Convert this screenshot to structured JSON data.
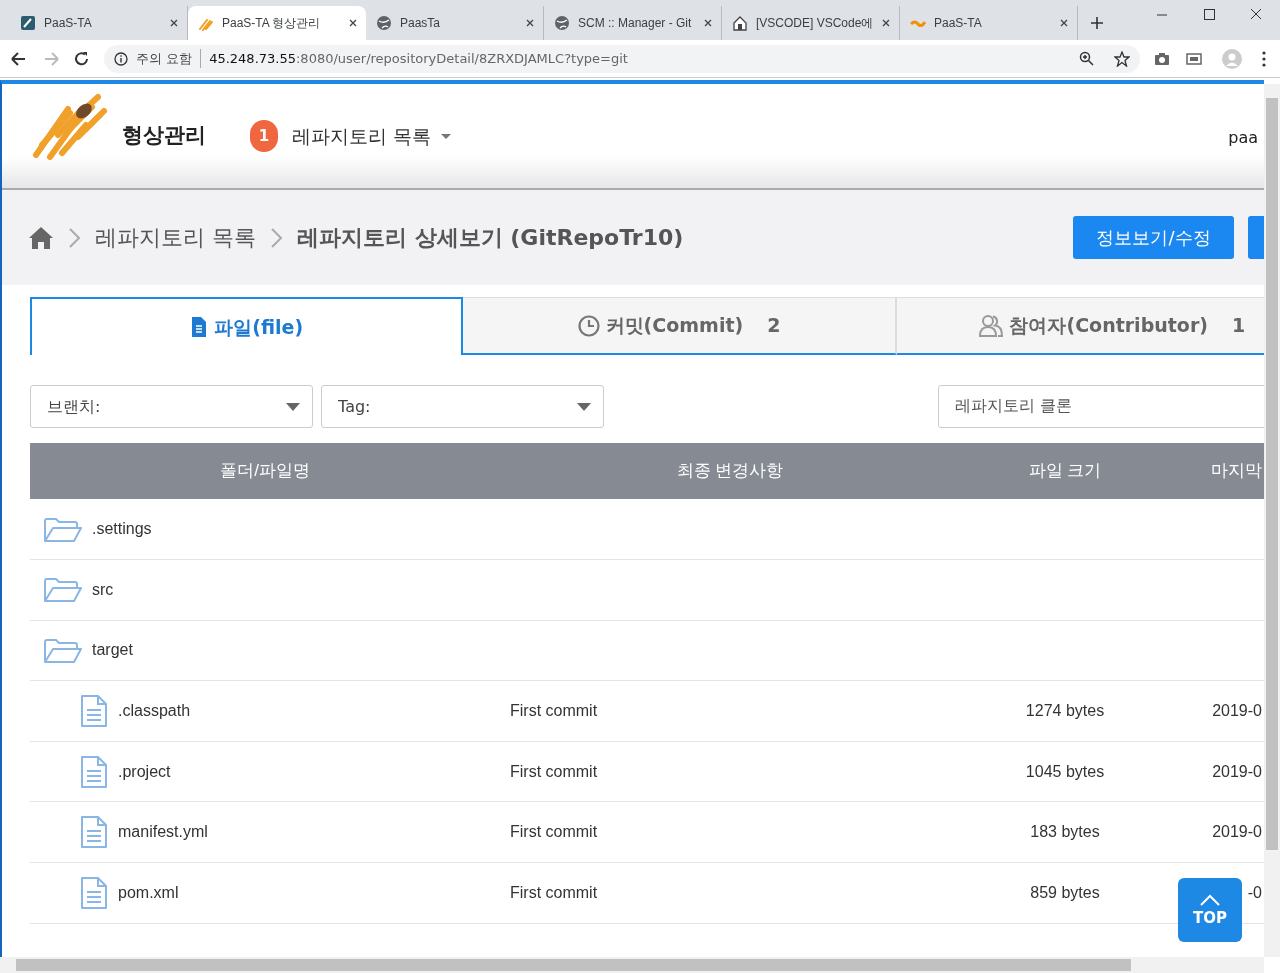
{
  "browser": {
    "tabs": [
      {
        "title": "PaaS-TA",
        "selected": false
      },
      {
        "title": "PaaS-TA 형상관리",
        "selected": true
      },
      {
        "title": "PaasTa",
        "selected": false
      },
      {
        "title": "SCM :: Manager - Git",
        "selected": false
      },
      {
        "title": "[VSCODE] VSCode에",
        "selected": false
      },
      {
        "title": "PaaS-TA",
        "selected": false
      }
    ],
    "security": "주의 요함",
    "host": "45.248.73.55",
    "url_rest": ":8080/user/repositoryDetail/8ZRXDJAMLC?type=git"
  },
  "header": {
    "title": "형상관리",
    "badge": "1",
    "menu": "레파지토리 목록",
    "user": "paa"
  },
  "breadcrumb": {
    "items": [
      "레파지토리 목록",
      "레파지토리 상세보기 (GitRepoTr10)"
    ],
    "button": "정보보기/수정"
  },
  "tabs": [
    {
      "label": "파일(file)",
      "selected": true
    },
    {
      "label": "커밋(Commit)",
      "count": "2",
      "selected": false
    },
    {
      "label": "참여자(Contributor)",
      "count": "1",
      "selected": false
    }
  ],
  "filters": {
    "branch": "브랜치:",
    "tag": "Tag:",
    "clone": "레파지토리 클론"
  },
  "table": {
    "columns": [
      "폴더/파일명",
      "최종 변경사항",
      "파일 크기",
      "마지막"
    ],
    "rows": [
      {
        "kind": "folder",
        "name": ".settings"
      },
      {
        "kind": "folder",
        "name": "src"
      },
      {
        "kind": "folder",
        "name": "target"
      },
      {
        "kind": "file",
        "name": ".classpath",
        "commit": "First commit",
        "size": "1274 bytes",
        "date": "2019-0"
      },
      {
        "kind": "file",
        "name": ".project",
        "commit": "First commit",
        "size": "1045 bytes",
        "date": "2019-0"
      },
      {
        "kind": "file",
        "name": "manifest.yml",
        "commit": "First commit",
        "size": "183 bytes",
        "date": "2019-0"
      },
      {
        "kind": "file",
        "name": "pom.xml",
        "commit": "First commit",
        "size": "859 bytes",
        "date": "-0"
      }
    ]
  },
  "top_button": "TOP"
}
